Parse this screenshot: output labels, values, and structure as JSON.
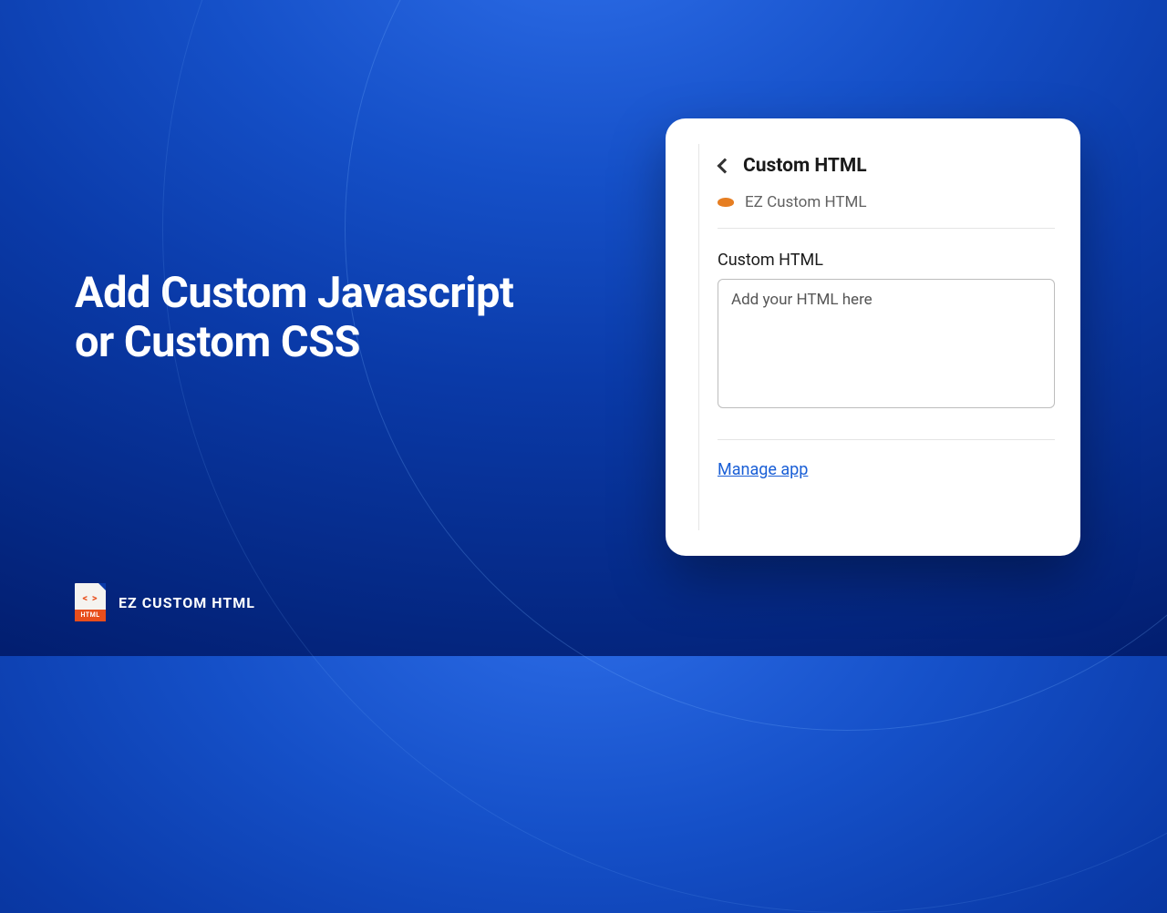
{
  "headline": {
    "line1": "Add Custom Javascript",
    "line2": "or Custom CSS"
  },
  "panel": {
    "title": "Custom HTML",
    "appName": "EZ Custom HTML",
    "fieldLabel": "Custom HTML",
    "placeholder": "Add your HTML here",
    "manageLink": "Manage app"
  },
  "logo": {
    "code": "< >",
    "band": "HTML",
    "text": "EZ CUSTOM HTML"
  }
}
